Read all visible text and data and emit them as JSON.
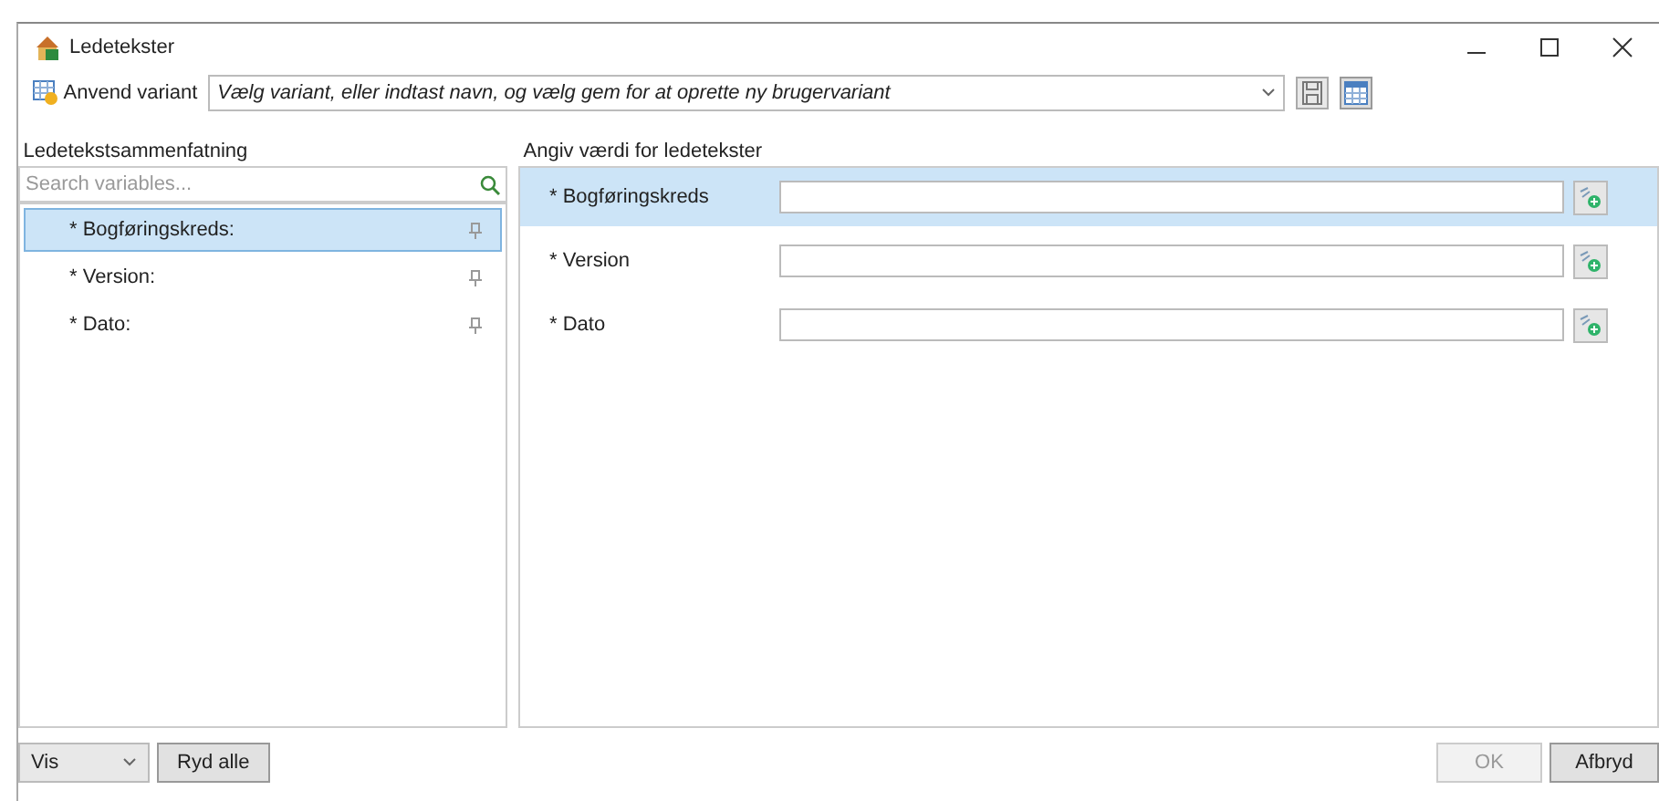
{
  "window": {
    "title": "Ledetekster"
  },
  "variant": {
    "label": "Anvend variant",
    "placeholder": "Vælg variant, eller indtast navn, og vælg gem for at oprette ny brugervariant"
  },
  "summary": {
    "heading": "Ledetekstsammenfatning",
    "search_placeholder": "Search variables...",
    "items": [
      {
        "label": "* Bogføringskreds:",
        "selected": true
      },
      {
        "label": "* Version:",
        "selected": false
      },
      {
        "label": "* Dato:",
        "selected": false
      }
    ]
  },
  "values": {
    "heading": "Angiv værdi for ledetekster",
    "rows": [
      {
        "label": "* Bogføringskreds",
        "selected": true
      },
      {
        "label": "* Version",
        "selected": false
      },
      {
        "label": "* Dato",
        "selected": false
      }
    ]
  },
  "footer": {
    "view": "Vis",
    "clear": "Ryd alle",
    "ok": {
      "label": "OK",
      "disabled": true
    },
    "cancel": {
      "label": "Afbryd",
      "disabled": false
    }
  }
}
